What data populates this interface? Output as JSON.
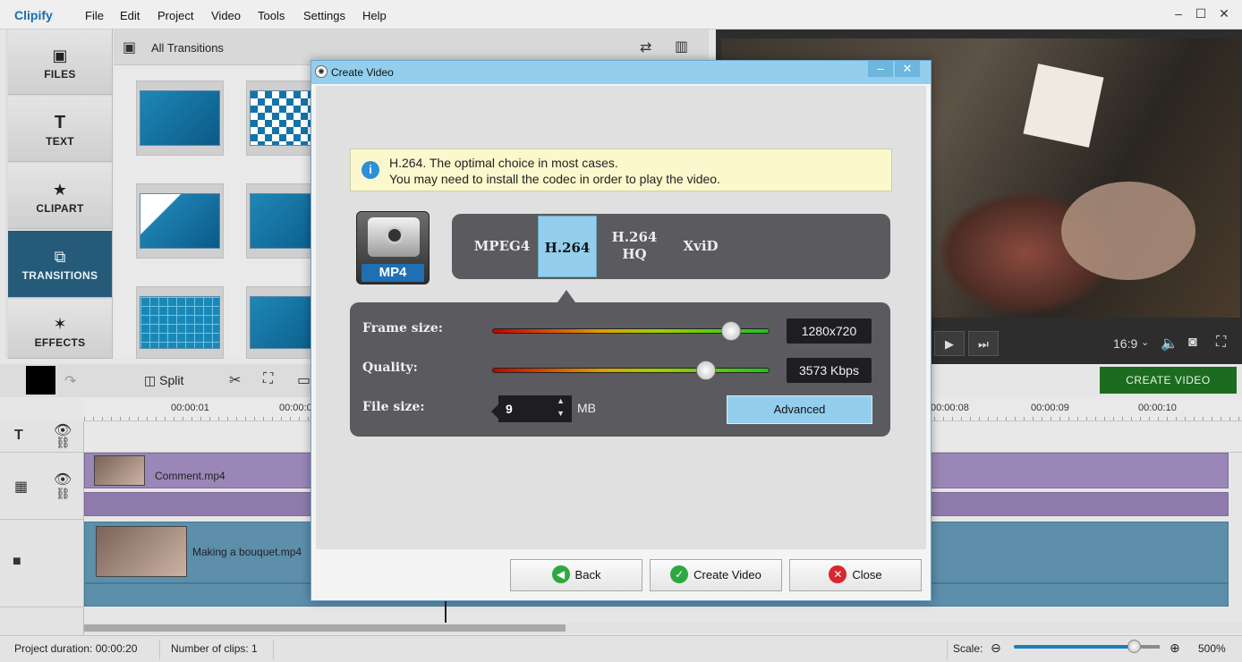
{
  "app": {
    "logo": "Clipify"
  },
  "menu": [
    "File",
    "Edit",
    "Project",
    "Video",
    "Tools",
    "Settings",
    "Help"
  ],
  "window_controls": {
    "minimize": "–",
    "maximize": "☐",
    "close": "✕"
  },
  "sidebar": {
    "items": [
      {
        "label": "FILES",
        "icon": "image-icon"
      },
      {
        "label": "TEXT",
        "icon": "text-icon"
      },
      {
        "label": "CLIPART",
        "icon": "star-icon"
      },
      {
        "label": "TRANSITIONS",
        "icon": "transitions-icon",
        "active": true
      },
      {
        "label": "EFFECTS",
        "icon": "magic-wand-icon"
      }
    ]
  },
  "transitions": {
    "title": "All Transitions"
  },
  "preview": {
    "aspect": "16:9"
  },
  "create_video_button": "CREATE VIDEO",
  "toolbar": {
    "split_label": "Split"
  },
  "ruler": {
    "ticks": [
      "00:00:01",
      "00:00:0",
      "00:00:08",
      "00:00:09",
      "00:00:10"
    ]
  },
  "tracks": {
    "clip1": "Comment.mp4",
    "clip2": "Making a bouquet.mp4"
  },
  "status": {
    "project_duration": "Project duration:  00:00:20",
    "clips": "Number of clips: 1",
    "scale_label": "Scale:",
    "scale_value": "500%",
    "scale_level": 0.82
  },
  "dialog": {
    "title": "Create Video",
    "info_line1": "H.264. The optimal choice in most cases.",
    "info_line2": "You may need to install the codec in order to play the video.",
    "format_logo": "MP4",
    "formats": [
      {
        "label": "MPEG4"
      },
      {
        "label": "H.264",
        "selected": true
      },
      {
        "label": "H.264\nHQ"
      },
      {
        "label": "XviD"
      }
    ],
    "frame_size_label": "Frame size:",
    "frame_size_value": "1280x720",
    "frame_size_level": 0.86,
    "quality_label": "Quality:",
    "quality_value": "3573 Kbps",
    "quality_level": 0.77,
    "file_size_label": "File size:",
    "file_size_value": "9",
    "file_size_unit": "MB",
    "advanced_label": "Advanced",
    "buttons": {
      "back": "Back",
      "create": "Create Video",
      "close": "Close"
    }
  }
}
